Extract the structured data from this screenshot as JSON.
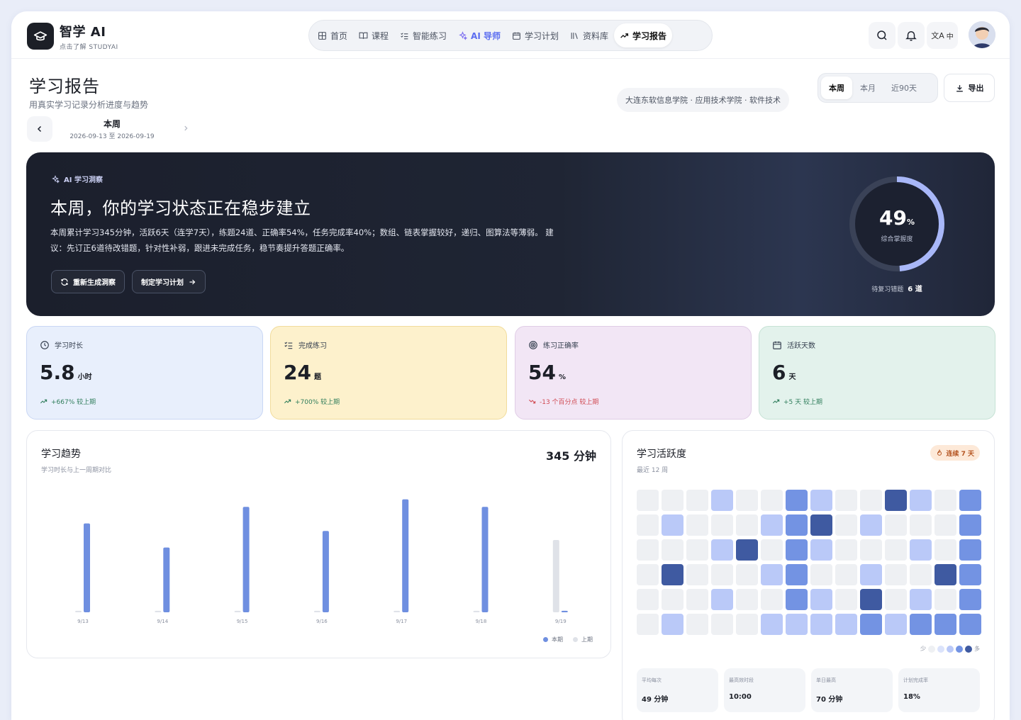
{
  "header": {
    "brand_name": "智学 AI",
    "brand_sub": "点击了解 STUDYAI",
    "nav": [
      {
        "label": "首页",
        "icon": "grid-icon"
      },
      {
        "label": "课程",
        "icon": "book-open-icon"
      },
      {
        "label": "智能练习",
        "icon": "checklist-icon"
      },
      {
        "label": "AI 导师",
        "icon": "sparkles-icon"
      },
      {
        "label": "学习计划",
        "icon": "calendar-icon"
      },
      {
        "label": "资料库",
        "icon": "library-icon"
      },
      {
        "label": "学习报告",
        "icon": "trending-up-icon"
      }
    ],
    "lang_label": "中"
  },
  "page": {
    "title": "学习报告",
    "subtitle": "用真实学习记录分析进度与趋势",
    "week_label": "本周",
    "week_range": "2026-09-13 至 2026-09-19",
    "school": "大连东软信息学院 · 应用技术学院 · 软件技术",
    "periods": [
      "本周",
      "本月",
      "近90天"
    ],
    "active_period": "本周",
    "export_label": "导出"
  },
  "insight": {
    "tag": "AI 学习洞察",
    "title": "本周，你的学习状态正在稳步建立",
    "body": "本周累计学习345分钟，活跃6天（连学7天），练题24道、正确率54%，任务完成率40%；数组、链表掌握较好，递归、图算法等薄弱。 建议：先订正6道待改错题，针对性补弱，跟进未完成任务，稳节奏提升答题正确率。",
    "regen_label": "重新生成洞察",
    "plan_label": "制定学习计划",
    "mastery_value": "49",
    "mastery_unit": "%",
    "mastery_fraction": 0.49,
    "mastery_label": "综合掌握度",
    "pending_label": "待复习错题",
    "pending_value": "6 道"
  },
  "stats": [
    {
      "label": "学习时长",
      "value": "5.8",
      "unit": "小时",
      "change": "+667% 较上期",
      "trend": "up",
      "icon": "clock-icon"
    },
    {
      "label": "完成练习",
      "value": "24",
      "unit": "题",
      "change": "+700% 较上期",
      "trend": "up",
      "icon": "checklist-icon"
    },
    {
      "label": "练习正确率",
      "value": "54",
      "unit": "%",
      "change": "-13 个百分点 较上期",
      "trend": "down",
      "icon": "target-icon"
    },
    {
      "label": "活跃天数",
      "value": "6",
      "unit": "天",
      "change": "+5 天 较上期",
      "trend": "up",
      "icon": "calendar-icon"
    }
  ],
  "trend": {
    "title": "学习趋势",
    "subtitle": "学习时长与上一周期对比",
    "total": "345 分钟",
    "legend_current": "本期",
    "legend_previous": "上期"
  },
  "chart_data": {
    "type": "bar",
    "categories": [
      "9/13",
      "9/14",
      "9/15",
      "9/16",
      "9/17",
      "9/18",
      "9/19"
    ],
    "series": [
      {
        "name": "本期",
        "values": [
          59,
          43,
          70,
          54,
          75,
          70,
          1
        ],
        "color": "#6f8fe0"
      },
      {
        "name": "上期",
        "values": [
          1,
          1,
          1,
          1,
          1,
          1,
          48
        ],
        "color": "#dfe2e8"
      }
    ],
    "ylim": [
      0,
      80
    ],
    "grid": false,
    "legend": "bottom-right"
  },
  "activity": {
    "title": "学习活跃度",
    "subtitle": "最近 12 周",
    "streak": "连续 7 天",
    "scale_low": "少",
    "scale_high": "多",
    "levels": [
      [
        0,
        0,
        0,
        1,
        0,
        0,
        2,
        1,
        0,
        0,
        3,
        1,
        0,
        2
      ],
      [
        0,
        1,
        0,
        0,
        0,
        1,
        2,
        3,
        0,
        1,
        0,
        0,
        0,
        2
      ],
      [
        0,
        0,
        0,
        1,
        3,
        0,
        2,
        1,
        0,
        0,
        0,
        1,
        0,
        2
      ],
      [
        0,
        3,
        0,
        0,
        0,
        1,
        2,
        0,
        0,
        1,
        0,
        0,
        3,
        2
      ],
      [
        0,
        0,
        0,
        1,
        0,
        0,
        2,
        1,
        0,
        3,
        0,
        1,
        0,
        2
      ],
      [
        0,
        1,
        0,
        0,
        0,
        1,
        1,
        1,
        1,
        2,
        1,
        2,
        2,
        2
      ]
    ],
    "minis": [
      {
        "label": "平均每次",
        "value": "49 分钟"
      },
      {
        "label": "最高效时段",
        "value": "10:00"
      },
      {
        "label": "单日最高",
        "value": "70 分钟"
      },
      {
        "label": "计划完成率",
        "value": "18%"
      }
    ]
  }
}
